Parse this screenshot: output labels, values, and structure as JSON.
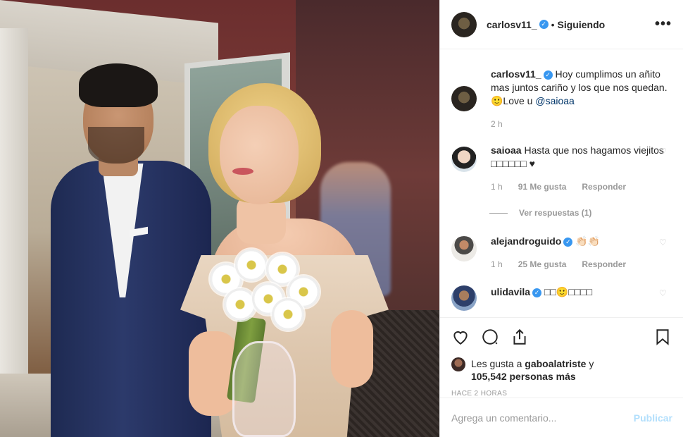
{
  "post": {
    "username": "carlosv11_",
    "verified_icon": "verified-badge-icon",
    "separator": "•",
    "follow_status": "Siguiendo",
    "more_icon": "more-options-icon"
  },
  "caption": {
    "username": "carlosv11_",
    "text": "Hoy cumplimos un añito mas juntos cariño y los que nos quedan. 🙂Love u",
    "mention": "@saioaa",
    "time": "2 h"
  },
  "comments": [
    {
      "username": "saioaa",
      "text": "Hasta que nos hagamos viejitos □□□□□□ ♥",
      "time": "1 h",
      "likes": "91 Me gusta",
      "reply_label": "Responder",
      "replies_label": "Ver respuestas (1)"
    },
    {
      "username": "alejandroguido",
      "text": "👏🏻👏🏻",
      "time": "1 h",
      "likes": "25 Me gusta",
      "reply_label": "Responder"
    },
    {
      "username": "ulidavila",
      "text": "□□🙂□□□□"
    }
  ],
  "actions": {
    "like_icon": "heart-icon",
    "comment_icon": "comment-icon",
    "share_icon": "share-icon",
    "save_icon": "bookmark-icon"
  },
  "likes": {
    "prefix": "Les gusta a",
    "user": "gaboalatriste",
    "joiner": "y",
    "others": "105,542 personas más"
  },
  "timestamp": "HACE 2 HORAS",
  "add_comment": {
    "placeholder": "Agrega un comentario...",
    "publish_label": "Publicar"
  },
  "colors": {
    "accent": "#3897f0",
    "publish_disabled": "#b2dffc",
    "muted": "#999999",
    "text": "#262626"
  }
}
